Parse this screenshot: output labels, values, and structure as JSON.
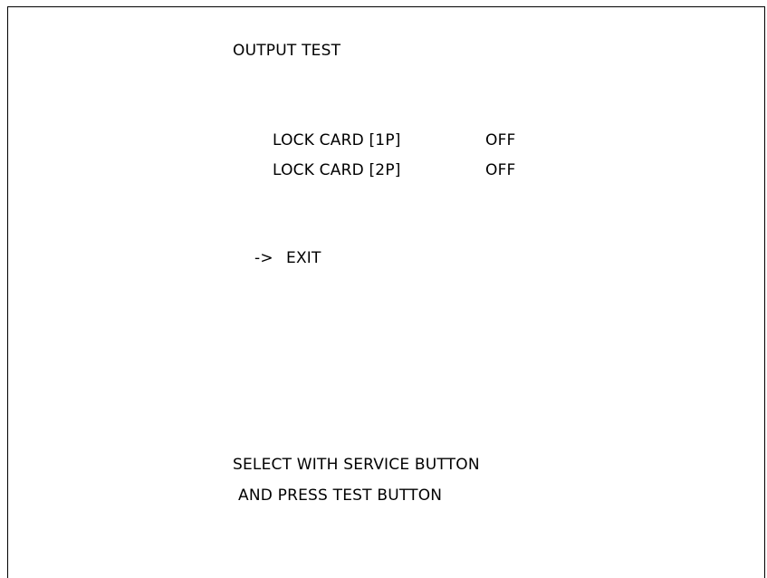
{
  "screen": {
    "title": "OUTPUT TEST",
    "items": [
      {
        "label": "LOCK CARD [1P]",
        "value": "OFF"
      },
      {
        "label": "LOCK CARD [2P]",
        "value": "OFF"
      }
    ],
    "cursor": "->",
    "exit_label": "EXIT",
    "instructions": [
      "SELECT WITH SERVICE BUTTON",
      "AND PRESS TEST BUTTON"
    ]
  }
}
